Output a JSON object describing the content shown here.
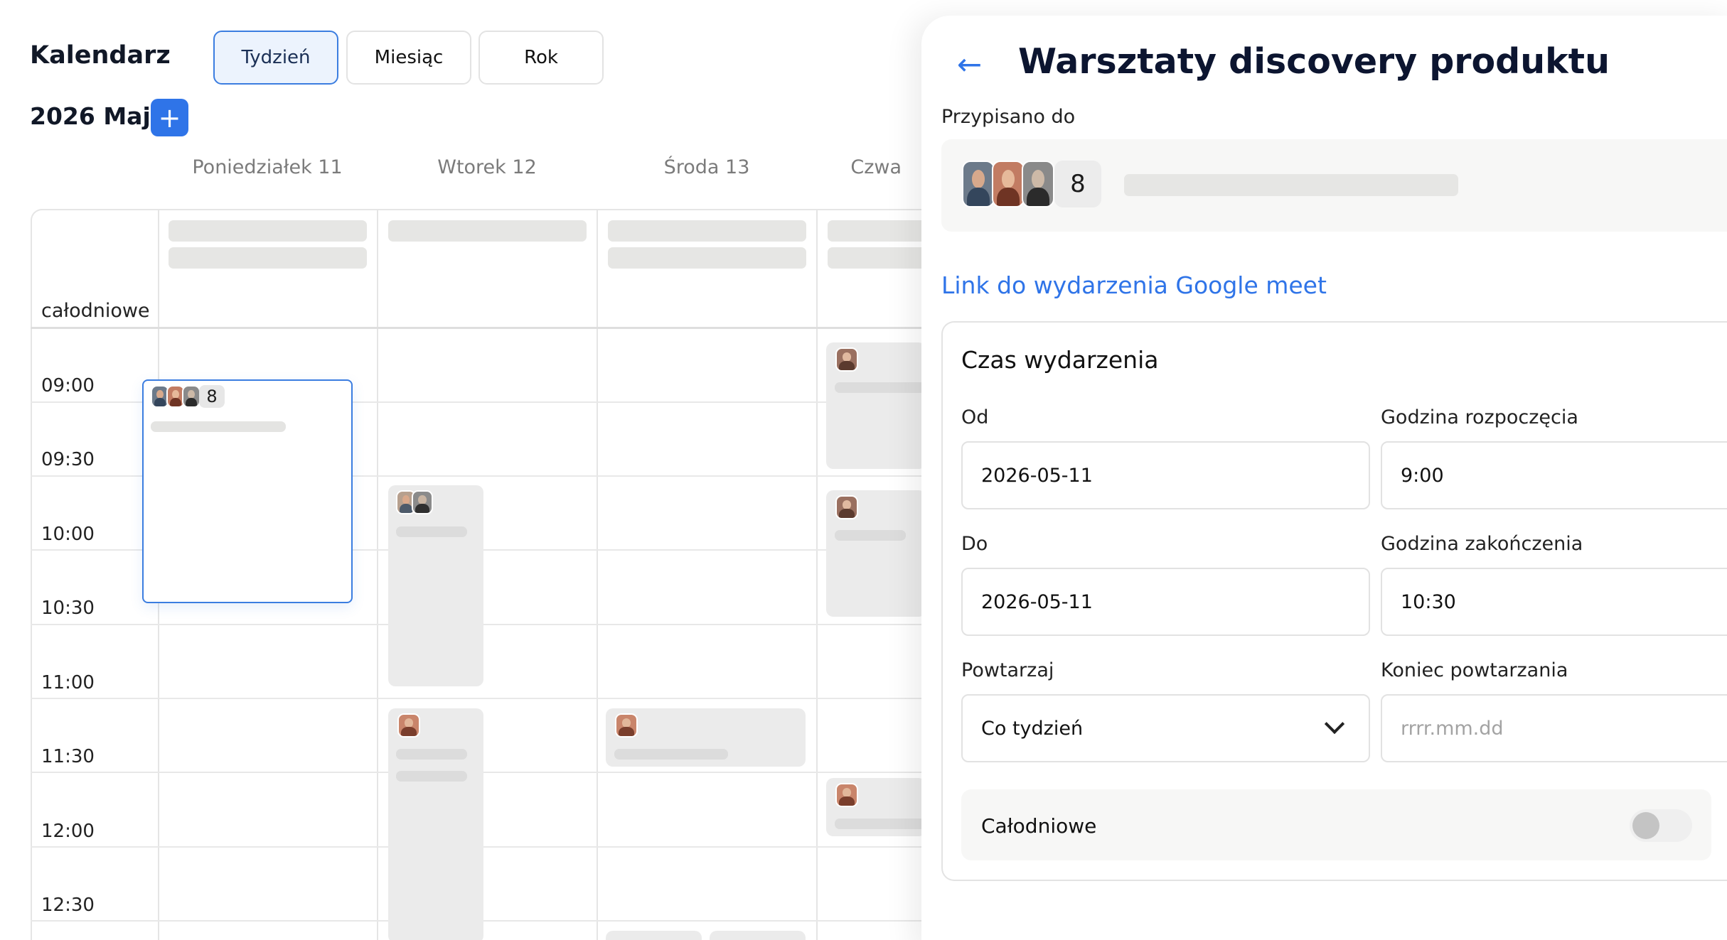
{
  "calendar": {
    "title": "Kalendarz",
    "views": [
      "Tydzień",
      "Miesiąc",
      "Rok"
    ],
    "active_view": "Tydzień",
    "month_label": "2026 Maj",
    "add_label": "+",
    "days": [
      "Poniedziałek 11",
      "Wtorek 12",
      "Środa 13",
      "Czwa"
    ],
    "allday_label": "całodniowe",
    "times": [
      "09:00",
      "09:30",
      "10:00",
      "10:30",
      "11:00",
      "11:30",
      "12:00",
      "12:30"
    ],
    "selected_event": {
      "attendee_count": "8"
    }
  },
  "panel": {
    "back_icon": "arrow-left-icon",
    "title": "Warsztaty discovery produktu",
    "assigned_label": "Przypisano do",
    "assigned_count": "8",
    "meet_link": "Link do wydarzenia Google meet",
    "time_section": {
      "title": "Czas wydarzenia",
      "from_label": "Od",
      "from_value": "2026-05-11",
      "start_time_label": "Godzina rozpoczęcia",
      "start_time_value": "9:00",
      "to_label": "Do",
      "to_value": "2026-05-11",
      "end_time_label": "Godzina zakończenia",
      "end_time_value": "10:30",
      "repeat_label": "Powtarzaj",
      "repeat_value": "Co tydzień",
      "repeat_end_label": "Koniec powtarzania",
      "repeat_end_placeholder": "rrrr.mm.dd",
      "allday_label": "Całodniowe",
      "allday_on": false
    }
  },
  "colors": {
    "accent": "#2f74e8",
    "selected_border": "#3b7de0",
    "skeleton": "#e6e6e4",
    "event_bg": "#ebebeb"
  }
}
